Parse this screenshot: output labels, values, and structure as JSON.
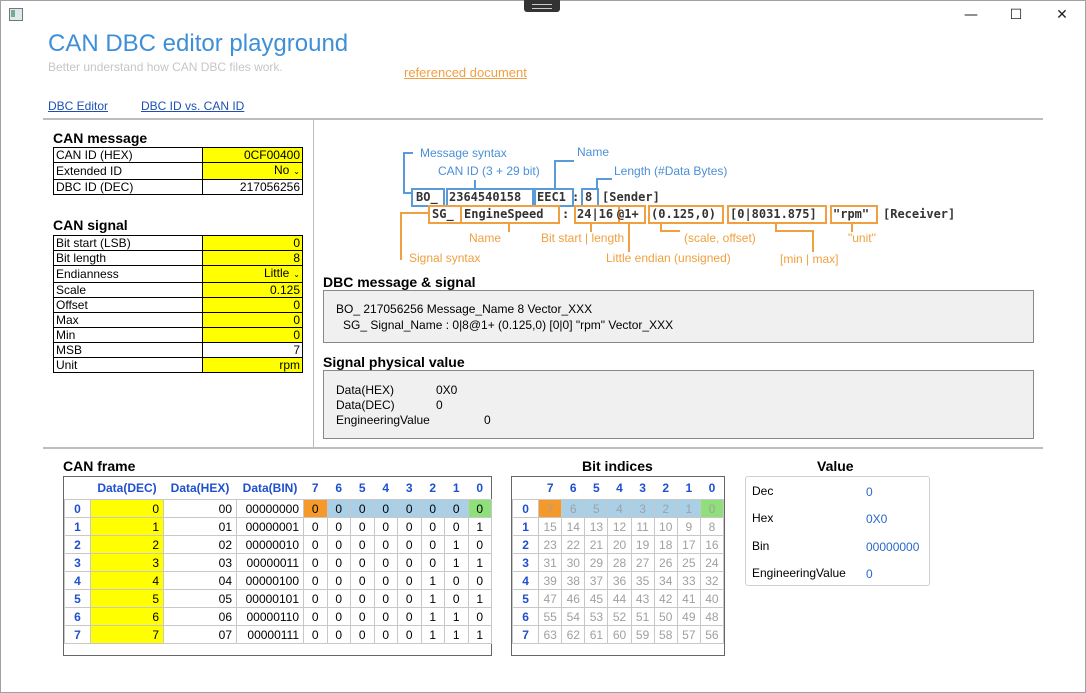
{
  "window": {
    "minimize": "—",
    "maximize": "☐",
    "close": "✕"
  },
  "header": {
    "title": "CAN DBC editor playground",
    "subtitle": "Better understand how CAN DBC files work.",
    "ref_link": "referenced document"
  },
  "nav": [
    {
      "label": "DBC Editor"
    },
    {
      "label": "DBC ID vs. CAN ID"
    }
  ],
  "can_message": {
    "title": "CAN message",
    "rows": [
      {
        "key": "CAN ID (HEX)",
        "value": "0CF00400"
      },
      {
        "key": "Extended ID",
        "value": "No"
      },
      {
        "key": "DBC ID (DEC)",
        "value": "217056256"
      }
    ]
  },
  "can_signal": {
    "title": "CAN signal",
    "rows": [
      {
        "key": "Bit start (LSB)",
        "value": "0"
      },
      {
        "key": "Bit length",
        "value": "8"
      },
      {
        "key": "Endianness",
        "value": "Little"
      },
      {
        "key": "Scale",
        "value": "0.125"
      },
      {
        "key": "Offset",
        "value": "0"
      },
      {
        "key": "Max",
        "value": "0"
      },
      {
        "key": "Min",
        "value": "0"
      },
      {
        "key": "MSB",
        "value": "7"
      },
      {
        "key": "Unit",
        "value": "rpm"
      }
    ]
  },
  "syntax": {
    "labels_blue": {
      "msg_syntax": "Message syntax",
      "name": "Name",
      "can_id": "CAN ID (3 + 29 bit)",
      "length": "Length (#Data Bytes)"
    },
    "bo_line": {
      "bo": "BO_",
      "id": "2364540158",
      "name": "EEC1",
      "colon": ":",
      "len": "8",
      "sender": "[Sender]"
    },
    "sg_line": {
      "sg": "SG_",
      "name": "EngineSpeed",
      "colon": ":",
      "start": "24|16",
      "at": "@1+",
      "scale": "(0.125,0)",
      "range": "[0|8031.875]",
      "unit": "\"rpm\"",
      "receiver": "[Receiver]"
    },
    "labels_orange": {
      "name": "Name",
      "bit": "Bit start | length",
      "scale": "(scale, offset)",
      "unit": "\"unit\"",
      "sig_syntax": "Signal syntax",
      "endian": "Little endian (unsigned)",
      "minmax": "[min | max]"
    }
  },
  "dbc_section": {
    "title": "DBC message & signal",
    "line1": "BO_ 217056256 Message_Name 8 Vector_XXX",
    "line2": "SG_ Signal_Name : 0|8@1+ (0.125,0) [0|0] \"rpm\" Vector_XXX"
  },
  "physical_section": {
    "title": "Signal physical value",
    "rows": [
      {
        "key": "Data(HEX)",
        "value": "0X0"
      },
      {
        "key": "Data(DEC)",
        "value": "0"
      },
      {
        "key": "EngineeringValue",
        "value": "0"
      }
    ]
  },
  "can_frame": {
    "title": "CAN frame",
    "headers": [
      "Data(DEC)",
      "Data(HEX)",
      "Data(BIN)",
      "7",
      "6",
      "5",
      "4",
      "3",
      "2",
      "1",
      "0"
    ],
    "rows": [
      {
        "idx": "0",
        "dec": "0",
        "hex": "00",
        "bin": "00000000",
        "bits": [
          "0",
          "0",
          "0",
          "0",
          "0",
          "0",
          "0",
          "0"
        ]
      },
      {
        "idx": "1",
        "dec": "1",
        "hex": "01",
        "bin": "00000001",
        "bits": [
          "0",
          "0",
          "0",
          "0",
          "0",
          "0",
          "0",
          "1"
        ]
      },
      {
        "idx": "2",
        "dec": "2",
        "hex": "02",
        "bin": "00000010",
        "bits": [
          "0",
          "0",
          "0",
          "0",
          "0",
          "0",
          "1",
          "0"
        ]
      },
      {
        "idx": "3",
        "dec": "3",
        "hex": "03",
        "bin": "00000011",
        "bits": [
          "0",
          "0",
          "0",
          "0",
          "0",
          "0",
          "1",
          "1"
        ]
      },
      {
        "idx": "4",
        "dec": "4",
        "hex": "04",
        "bin": "00000100",
        "bits": [
          "0",
          "0",
          "0",
          "0",
          "0",
          "1",
          "0",
          "0"
        ]
      },
      {
        "idx": "5",
        "dec": "5",
        "hex": "05",
        "bin": "00000101",
        "bits": [
          "0",
          "0",
          "0",
          "0",
          "0",
          "1",
          "0",
          "1"
        ]
      },
      {
        "idx": "6",
        "dec": "6",
        "hex": "06",
        "bin": "00000110",
        "bits": [
          "0",
          "0",
          "0",
          "0",
          "0",
          "1",
          "1",
          "0"
        ]
      },
      {
        "idx": "7",
        "dec": "7",
        "hex": "07",
        "bin": "00000111",
        "bits": [
          "0",
          "0",
          "0",
          "0",
          "0",
          "1",
          "1",
          "1"
        ]
      }
    ]
  },
  "bit_indices": {
    "title": "Bit indices",
    "headers": [
      "7",
      "6",
      "5",
      "4",
      "3",
      "2",
      "1",
      "0"
    ],
    "rows": [
      {
        "idx": "0",
        "bits": [
          "7",
          "6",
          "5",
          "4",
          "3",
          "2",
          "1",
          "0"
        ]
      },
      {
        "idx": "1",
        "bits": [
          "15",
          "14",
          "13",
          "12",
          "11",
          "10",
          "9",
          "8"
        ]
      },
      {
        "idx": "2",
        "bits": [
          "23",
          "22",
          "21",
          "20",
          "19",
          "18",
          "17",
          "16"
        ]
      },
      {
        "idx": "3",
        "bits": [
          "31",
          "30",
          "29",
          "28",
          "27",
          "26",
          "25",
          "24"
        ]
      },
      {
        "idx": "4",
        "bits": [
          "39",
          "38",
          "37",
          "36",
          "35",
          "34",
          "33",
          "32"
        ]
      },
      {
        "idx": "5",
        "bits": [
          "47",
          "46",
          "45",
          "44",
          "43",
          "42",
          "41",
          "40"
        ]
      },
      {
        "idx": "6",
        "bits": [
          "55",
          "54",
          "53",
          "52",
          "51",
          "50",
          "49",
          "48"
        ]
      },
      {
        "idx": "7",
        "bits": [
          "63",
          "62",
          "61",
          "60",
          "59",
          "58",
          "57",
          "56"
        ]
      }
    ]
  },
  "value_panel": {
    "title": "Value",
    "rows": [
      {
        "key": "Dec",
        "value": "0"
      },
      {
        "key": "Hex",
        "value": "0X0"
      },
      {
        "key": "Bin",
        "value": "00000000"
      },
      {
        "key": "EngineeringValue",
        "value": "0"
      }
    ]
  }
}
